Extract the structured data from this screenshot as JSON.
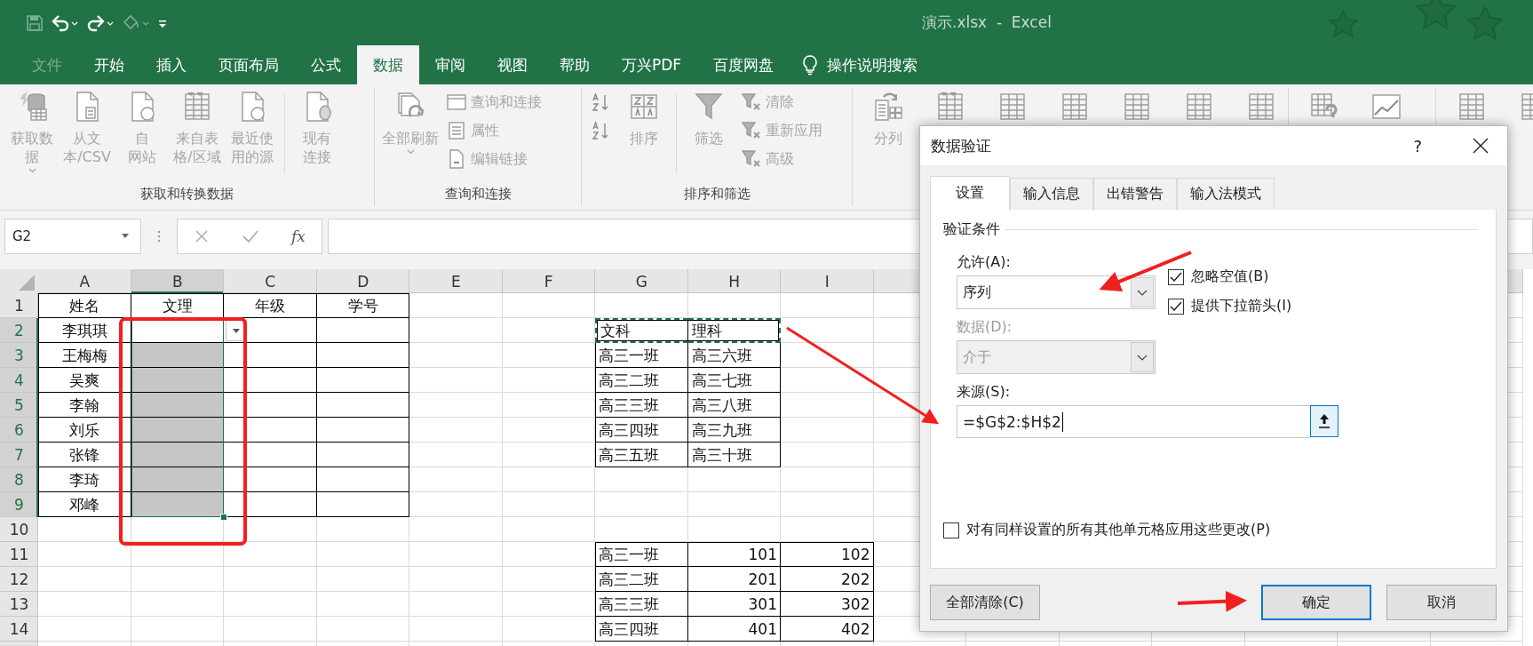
{
  "title_bar": {
    "title": "演示.xlsx  -  Excel",
    "quick_access": [
      {
        "kind": "save",
        "disabled": true
      },
      {
        "kind": "undo",
        "disabled": false
      },
      {
        "kind": "redo",
        "disabled": false
      },
      {
        "kind": "painter",
        "disabled": true
      },
      {
        "kind": "customize",
        "disabled": false
      }
    ]
  },
  "ribbon_tabs": [
    {
      "label": "文件",
      "selected": false,
      "disabled": true
    },
    {
      "label": "开始",
      "selected": false,
      "disabled": false
    },
    {
      "label": "插入",
      "selected": false,
      "disabled": false
    },
    {
      "label": "页面布局",
      "selected": false,
      "disabled": false
    },
    {
      "label": "公式",
      "selected": false,
      "disabled": false
    },
    {
      "label": "数据",
      "selected": true,
      "disabled": false
    },
    {
      "label": "审阅",
      "selected": false,
      "disabled": false
    },
    {
      "label": "视图",
      "selected": false,
      "disabled": false
    },
    {
      "label": "帮助",
      "selected": false,
      "disabled": false
    },
    {
      "label": "万兴PDF",
      "selected": false,
      "disabled": false
    },
    {
      "label": "百度网盘",
      "selected": false,
      "disabled": false
    }
  ],
  "tell_me": {
    "label": "操作说明搜索"
  },
  "ribbon_groups": [
    {
      "label": "获取和转换数据",
      "buttons": [
        {
          "kind": "large",
          "lines": [
            "获取数",
            "据"
          ],
          "dropdown": true
        },
        {
          "kind": "large",
          "lines": [
            "从文",
            "本/CSV"
          ]
        },
        {
          "kind": "large",
          "lines": [
            "自",
            "网站"
          ]
        },
        {
          "kind": "large",
          "lines": [
            "来自表",
            "格/区域"
          ]
        },
        {
          "kind": "large",
          "lines": [
            "最近使",
            "用的源"
          ]
        },
        {
          "kind": "separator"
        },
        {
          "kind": "large",
          "lines": [
            "现有",
            "连接"
          ]
        }
      ]
    },
    {
      "label": "查询和连接",
      "buttons": [
        {
          "kind": "large",
          "lines": [
            "全部刷新"
          ],
          "dropdown": true
        },
        {
          "kind": "stack",
          "items": [
            {
              "kind": "text",
              "label": "查询和连接"
            },
            {
              "kind": "text",
              "label": "属性"
            },
            {
              "kind": "text",
              "label": "编辑链接"
            }
          ]
        }
      ]
    },
    {
      "label": "排序和筛选",
      "buttons": [
        {
          "kind": "stack",
          "items": [
            {
              "kind": "icon"
            },
            {
              "kind": "icon"
            }
          ]
        },
        {
          "kind": "large",
          "lines": [
            "排序"
          ]
        },
        {
          "kind": "separator"
        },
        {
          "kind": "large",
          "lines": [
            "筛选"
          ]
        },
        {
          "kind": "stack",
          "items": [
            {
              "kind": "text",
              "label": "清除"
            },
            {
              "kind": "text",
              "label": "重新应用"
            },
            {
              "kind": "text",
              "label": "高级"
            }
          ]
        }
      ]
    },
    {
      "buttons": [
        {
          "kind": "large",
          "lines": [
            "分列"
          ]
        },
        {
          "kind": "large"
        },
        {
          "kind": "large"
        },
        {
          "kind": "large"
        },
        {
          "kind": "large"
        },
        {
          "kind": "large"
        },
        {
          "kind": "large"
        }
      ]
    },
    {
      "buttons": [
        {
          "kind": "large"
        },
        {
          "kind": "large"
        }
      ]
    },
    {
      "buttons": [
        {
          "kind": "large"
        },
        {
          "kind": "large"
        }
      ]
    }
  ],
  "formula_bar": {
    "name_box": "G2",
    "function_button": "fx"
  },
  "sheet": {
    "columns": [
      {
        "label": "A",
        "selected": false
      },
      {
        "label": "B",
        "selected": true
      },
      {
        "label": "C",
        "selected": false
      },
      {
        "label": "D",
        "selected": false
      },
      {
        "label": "E",
        "selected": false
      },
      {
        "label": "F",
        "selected": false
      },
      {
        "label": "G",
        "selected": false
      },
      {
        "label": "H",
        "selected": false
      },
      {
        "label": "I",
        "selected": false
      }
    ],
    "rows": [
      {
        "number": "1",
        "selected": false,
        "cells": {
          "A": {
            "text": "姓名",
            "kind": "center",
            "bordered": true
          },
          "B": {
            "text": "文理",
            "kind": "center",
            "bordered": true
          },
          "C": {
            "text": "年级",
            "kind": "center",
            "bordered": true
          },
          "D": {
            "text": "学号",
            "kind": "center",
            "bordered": true
          }
        }
      },
      {
        "number": "2",
        "selected": true,
        "cells": {
          "A": {
            "text": "李琪琪",
            "kind": "center",
            "bordered": true
          },
          "B": {
            "dropdown": true,
            "bordered": true
          },
          "C": {
            "bordered": true
          },
          "D": {
            "bordered": true
          },
          "G": {
            "text": "文科",
            "kind": "left",
            "bordered": true,
            "marquee": true
          },
          "H": {
            "text": "理科",
            "kind": "left",
            "bordered": true,
            "marquee": true
          }
        }
      },
      {
        "number": "3",
        "selected": true,
        "cells": {
          "A": {
            "text": "王梅梅",
            "kind": "center",
            "bordered": true
          },
          "B": {
            "bordered": true
          },
          "C": {
            "bordered": true
          },
          "D": {
            "bordered": true
          },
          "G": {
            "text": "高三一班",
            "kind": "left",
            "bordered": true
          },
          "H": {
            "text": "高三六班",
            "kind": "left",
            "bordered": true
          }
        }
      },
      {
        "number": "4",
        "selected": true,
        "cells": {
          "A": {
            "text": "吴爽",
            "kind": "center",
            "bordered": true
          },
          "B": {
            "bordered": true
          },
          "C": {
            "bordered": true
          },
          "D": {
            "bordered": true
          },
          "G": {
            "text": "高三二班",
            "kind": "left",
            "bordered": true
          },
          "H": {
            "text": "高三七班",
            "kind": "left",
            "bordered": true
          }
        }
      },
      {
        "number": "5",
        "selected": true,
        "cells": {
          "A": {
            "text": "李翰",
            "kind": "center",
            "bordered": true
          },
          "B": {
            "bordered": true
          },
          "C": {
            "bordered": true
          },
          "D": {
            "bordered": true
          },
          "G": {
            "text": "高三三班",
            "kind": "left",
            "bordered": true
          },
          "H": {
            "text": "高三八班",
            "kind": "left",
            "bordered": true
          }
        }
      },
      {
        "number": "6",
        "selected": true,
        "cells": {
          "A": {
            "text": "刘乐",
            "kind": "center",
            "bordered": true
          },
          "B": {
            "bordered": true
          },
          "C": {
            "bordered": true
          },
          "D": {
            "bordered": true
          },
          "G": {
            "text": "高三四班",
            "kind": "left",
            "bordered": true
          },
          "H": {
            "text": "高三九班",
            "kind": "left",
            "bordered": true
          }
        }
      },
      {
        "number": "7",
        "selected": true,
        "cells": {
          "A": {
            "text": "张锋",
            "kind": "center",
            "bordered": true
          },
          "B": {
            "bordered": true
          },
          "C": {
            "bordered": true
          },
          "D": {
            "bordered": true
          },
          "G": {
            "text": "高三五班",
            "kind": "left",
            "bordered": true
          },
          "H": {
            "text": "高三十班",
            "kind": "left",
            "bordered": true
          }
        }
      },
      {
        "number": "8",
        "selected": true,
        "cells": {
          "A": {
            "text": "李琦",
            "kind": "center",
            "bordered": true
          },
          "B": {
            "bordered": true
          },
          "C": {
            "bordered": true
          },
          "D": {
            "bordered": true
          }
        }
      },
      {
        "number": "9",
        "selected": true,
        "cells": {
          "A": {
            "text": "邓峰",
            "kind": "center",
            "bordered": true
          },
          "B": {
            "bordered": true
          },
          "C": {
            "bordered": true
          },
          "D": {
            "bordered": true
          }
        }
      },
      {
        "number": "10",
        "selected": false,
        "cells": {}
      },
      {
        "number": "11",
        "selected": false,
        "cells": {
          "G": {
            "text": "高三一班",
            "kind": "left",
            "bordered": true
          },
          "H": {
            "text": "101",
            "kind": "number",
            "bordered": true
          },
          "I": {
            "text": "102",
            "kind": "number",
            "bordered": true
          }
        }
      },
      {
        "number": "12",
        "selected": false,
        "cells": {
          "G": {
            "text": "高三二班",
            "kind": "left",
            "bordered": true
          },
          "H": {
            "text": "201",
            "kind": "number",
            "bordered": true
          },
          "I": {
            "text": "202",
            "kind": "number",
            "bordered": true
          }
        }
      },
      {
        "number": "13",
        "selected": false,
        "cells": {
          "G": {
            "text": "高三三班",
            "kind": "left",
            "bordered": true
          },
          "H": {
            "text": "301",
            "kind": "number",
            "bordered": true
          },
          "I": {
            "text": "302",
            "kind": "number",
            "bordered": true
          }
        }
      },
      {
        "number": "14",
        "selected": false,
        "cells": {
          "G": {
            "text": "高三四班",
            "kind": "left",
            "bordered": true
          },
          "H": {
            "text": "401",
            "kind": "number",
            "bordered": true
          },
          "I": {
            "text": "402",
            "kind": "number",
            "bordered": true
          }
        }
      }
    ]
  },
  "dialog": {
    "title": "数据验证",
    "help": "?",
    "tabs": [
      {
        "label": "设置",
        "selected": true
      },
      {
        "label": "输入信息",
        "selected": false
      },
      {
        "label": "出错警告",
        "selected": false
      },
      {
        "label": "输入法模式",
        "selected": false
      }
    ],
    "section": "验证条件",
    "allow": {
      "label": "允许(A):",
      "value": "序列",
      "disabled": false
    },
    "data": {
      "label": "数据(D):",
      "value": "介于",
      "disabled": true
    },
    "checkboxes": [
      {
        "label": "忽略空值(B)",
        "checked": true
      },
      {
        "label": "提供下拉箭头(I)",
        "checked": true
      }
    ],
    "source": {
      "label": "来源(S):",
      "value": "=$G$2:$H$2"
    },
    "apply_all": {
      "label": "对有同样设置的所有其他单元格应用这些更改(P)",
      "checked": false
    },
    "buttons": [
      {
        "label": "全部清除(C)",
        "kind": "clear"
      },
      {
        "label": "确定",
        "kind": "default"
      },
      {
        "label": "取消",
        "kind": "cancel"
      }
    ]
  }
}
